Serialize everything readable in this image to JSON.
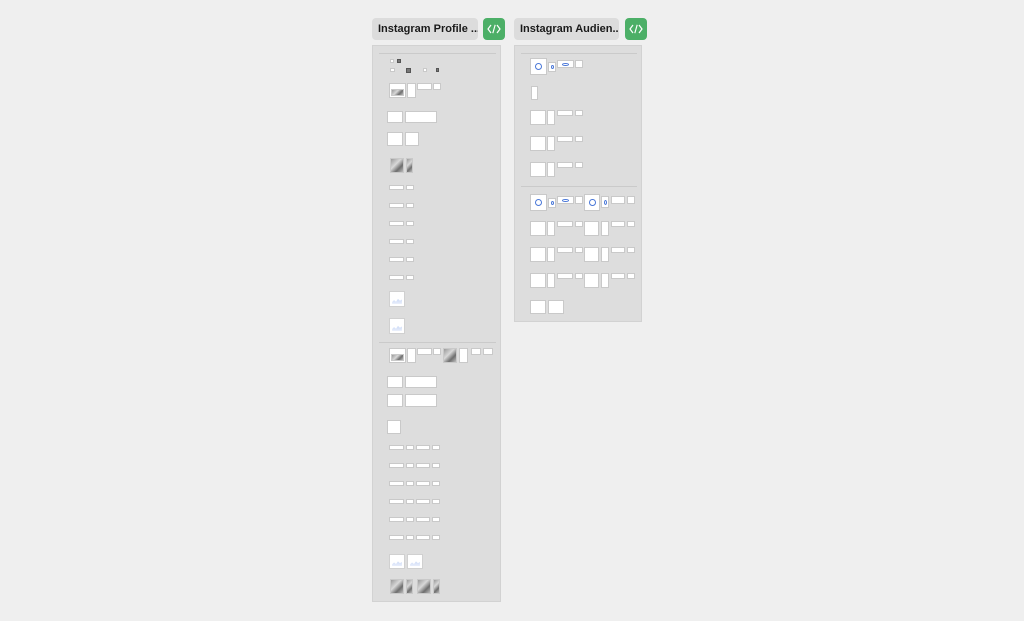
{
  "frames": [
    {
      "id": "profile",
      "title": "Instagram Profile ...",
      "code_button_icon": "code-icon"
    },
    {
      "id": "audience",
      "title": "Instagram Audien...",
      "code_button_icon": "code-icon"
    }
  ],
  "colors": {
    "background": "#efefef",
    "code_button": "#4caf67",
    "frame_board": "#dddddd",
    "title_chip": "#dcdcdc"
  }
}
